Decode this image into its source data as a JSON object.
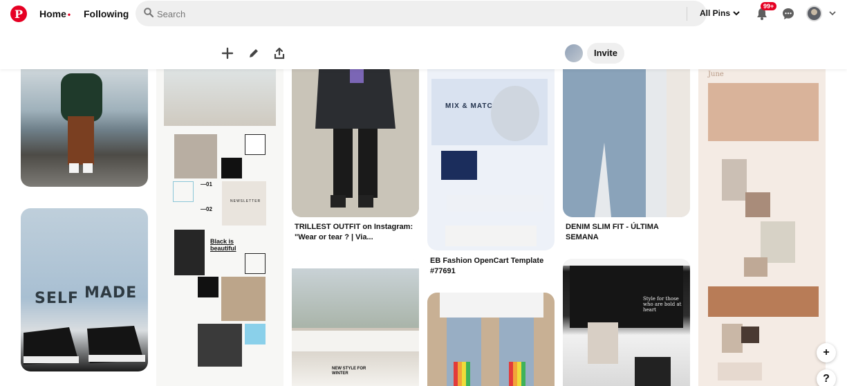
{
  "topbar": {
    "logo_glyph": "P",
    "nav_home": "Home",
    "nav_home_dot": "•",
    "nav_following": "Following",
    "search_placeholder": "Search",
    "filter_label": "All Pins",
    "notification_count": "99+",
    "brand_color": "#e60023"
  },
  "board": {
    "invite_label": "Invite"
  },
  "pins": {
    "trillest_caption": "TRILLEST OUTFIT on Instagram: \"Wear or tear ? | Via...",
    "eb_caption": "EB Fashion OpenCart Template #77691",
    "denim_caption": "DENIM SLIM FIT - ÚLTIMA SEMANA",
    "mix_heading": "MIX & MATCH",
    "jeans_text_left": "SELF",
    "jeans_text_right": "MADE",
    "collage_badge": "Black is beautiful",
    "collage_newsletter": "NEWSLETTER",
    "collage_numbers": [
      "—01",
      "—02"
    ],
    "june_title": "June",
    "fashion_banner": "NEW STYLE FOR WINTER",
    "bw_text": "Style for those who are bold at heart"
  },
  "floating": {
    "add_label": "+",
    "help_label": "?"
  }
}
